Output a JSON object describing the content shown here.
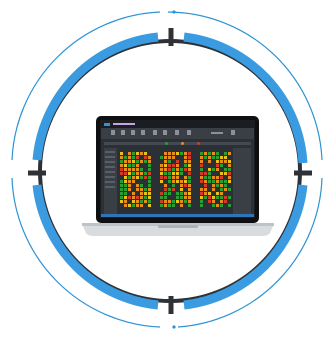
{
  "colors": {
    "ring_outer": "#2b93d6",
    "ring_thick": "#3a9be0",
    "ring_dark": "#2e3136",
    "laptop_body": "#d9dcdf",
    "laptop_bezel": "#0e0f11",
    "grid_green": "#2a9d35",
    "grid_orange": "#e88c1c",
    "grid_yellow": "#e8c21a",
    "grid_red": "#d43a2a"
  },
  "icons": [
    "circular-frame-icon",
    "laptop-icon"
  ]
}
